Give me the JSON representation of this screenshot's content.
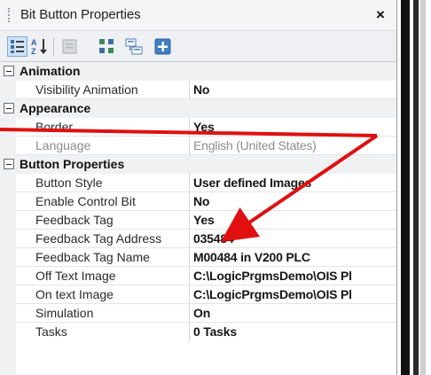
{
  "window": {
    "title": "Bit Button Properties",
    "close_label": "×"
  },
  "toolbar": {
    "buttons": [
      {
        "icon": "categorized-icon"
      },
      {
        "icon": "alphabetical-icon"
      },
      {
        "icon": "property-pages-icon"
      },
      {
        "icon": "expand-all-icon"
      },
      {
        "icon": "collapse-all-icon"
      },
      {
        "icon": "add-icon"
      }
    ]
  },
  "categories": {
    "animation": {
      "label": "Animation",
      "rows": [
        {
          "name": "Visibility Animation",
          "value": "No"
        }
      ]
    },
    "appearance": {
      "label": "Appearance",
      "rows": [
        {
          "name": "Border",
          "value": "Yes"
        },
        {
          "name": "Language",
          "value": "English (United States)"
        }
      ]
    },
    "button_properties": {
      "label": "Button Properties",
      "rows": [
        {
          "name": "Button Style",
          "value": "User defined Images"
        },
        {
          "name": "Enable Control Bit",
          "value": "No"
        },
        {
          "name": "Feedback Tag",
          "value": "Yes"
        },
        {
          "name": "Feedback Tag Address",
          "value": "035484"
        },
        {
          "name": "Feedback Tag Name",
          "value": "M00484 in V200 PLC"
        },
        {
          "name": "Off Text Image",
          "value": "C:\\LogicPrgmsDemo\\OIS Pl"
        },
        {
          "name": "On text Image",
          "value": "C:\\LogicPrgmsDemo\\OIS Pl"
        },
        {
          "name": "Simulation",
          "value": "On"
        },
        {
          "name": "Tasks",
          "value": "0 Tasks"
        }
      ]
    }
  },
  "annotation": {
    "color": "#e01010"
  }
}
